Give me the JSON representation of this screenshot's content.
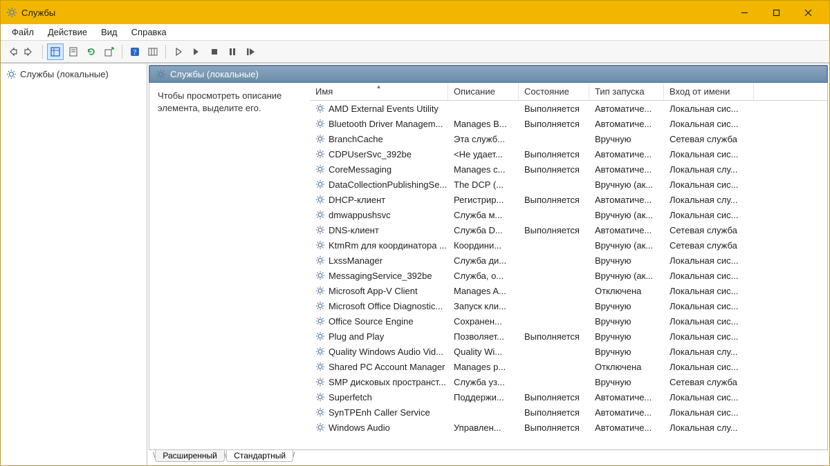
{
  "window": {
    "title": "Службы"
  },
  "menu": {
    "items": [
      "Файл",
      "Действие",
      "Вид",
      "Справка"
    ]
  },
  "tree": {
    "item": "Службы (локальные)"
  },
  "rightHeader": "Службы (локальные)",
  "descPane": "Чтобы просмотреть описание элемента, выделите его.",
  "columns": [
    "Имя",
    "Описание",
    "Состояние",
    "Тип запуска",
    "Вход от имени"
  ],
  "tabs": {
    "extended": "Расширенный",
    "standard": "Стандартный"
  },
  "services": [
    {
      "name": "AMD External Events Utility",
      "desc": "",
      "state": "Выполняется",
      "startup": "Автоматиче...",
      "logon": "Локальная сис..."
    },
    {
      "name": "Bluetooth Driver Managem...",
      "desc": "Manages B...",
      "state": "Выполняется",
      "startup": "Автоматиче...",
      "logon": "Локальная сис..."
    },
    {
      "name": "BranchCache",
      "desc": "Эта служб...",
      "state": "",
      "startup": "Вручную",
      "logon": "Сетевая служба"
    },
    {
      "name": "CDPUserSvc_392be",
      "desc": "<Не удает...",
      "state": "Выполняется",
      "startup": "Автоматиче...",
      "logon": "Локальная сис..."
    },
    {
      "name": "CoreMessaging",
      "desc": "Manages c...",
      "state": "Выполняется",
      "startup": "Автоматиче...",
      "logon": "Локальная слу..."
    },
    {
      "name": "DataCollectionPublishingSe...",
      "desc": "The DCP (...",
      "state": "",
      "startup": "Вручную (ак...",
      "logon": "Локальная сис..."
    },
    {
      "name": "DHCP-клиент",
      "desc": "Регистрир...",
      "state": "Выполняется",
      "startup": "Автоматиче...",
      "logon": "Локальная слу..."
    },
    {
      "name": "dmwappushsvc",
      "desc": "Служба м...",
      "state": "",
      "startup": "Вручную (ак...",
      "logon": "Локальная сис..."
    },
    {
      "name": "DNS-клиент",
      "desc": "Служба D...",
      "state": "Выполняется",
      "startup": "Автоматиче...",
      "logon": "Сетевая служба"
    },
    {
      "name": "KtmRm для координатора ...",
      "desc": "Координи...",
      "state": "",
      "startup": "Вручную (ак...",
      "logon": "Сетевая служба"
    },
    {
      "name": "LxssManager",
      "desc": "Служба ди...",
      "state": "",
      "startup": "Вручную",
      "logon": "Локальная сис..."
    },
    {
      "name": "MessagingService_392be",
      "desc": "Служба, о...",
      "state": "",
      "startup": "Вручную (ак...",
      "logon": "Локальная сис..."
    },
    {
      "name": "Microsoft App-V Client",
      "desc": "Manages A...",
      "state": "",
      "startup": "Отключена",
      "logon": "Локальная сис..."
    },
    {
      "name": "Microsoft Office Diagnostic...",
      "desc": "Запуск кли...",
      "state": "",
      "startup": "Вручную",
      "logon": "Локальная сис..."
    },
    {
      "name": "Office Source Engine",
      "desc": "Сохранен...",
      "state": "",
      "startup": "Вручную",
      "logon": "Локальная сис..."
    },
    {
      "name": "Plug and Play",
      "desc": "Позволяет...",
      "state": "Выполняется",
      "startup": "Вручную",
      "logon": "Локальная сис..."
    },
    {
      "name": "Quality Windows Audio Vid...",
      "desc": "Quality Wi...",
      "state": "",
      "startup": "Вручную",
      "logon": "Локальная слу..."
    },
    {
      "name": "Shared PC Account Manager",
      "desc": "Manages p...",
      "state": "",
      "startup": "Отключена",
      "logon": "Локальная сис..."
    },
    {
      "name": "SMP дисковых пространст...",
      "desc": "Служба уз...",
      "state": "",
      "startup": "Вручную",
      "logon": "Сетевая служба"
    },
    {
      "name": "Superfetch",
      "desc": "Поддержи...",
      "state": "Выполняется",
      "startup": "Автоматиче...",
      "logon": "Локальная сис..."
    },
    {
      "name": "SynTPEnh Caller Service",
      "desc": "",
      "state": "Выполняется",
      "startup": "Автоматиче...",
      "logon": "Локальная сис..."
    },
    {
      "name": "Windows Audio",
      "desc": "Управлен...",
      "state": "Выполняется",
      "startup": "Автоматиче...",
      "logon": "Локальная слу..."
    }
  ]
}
